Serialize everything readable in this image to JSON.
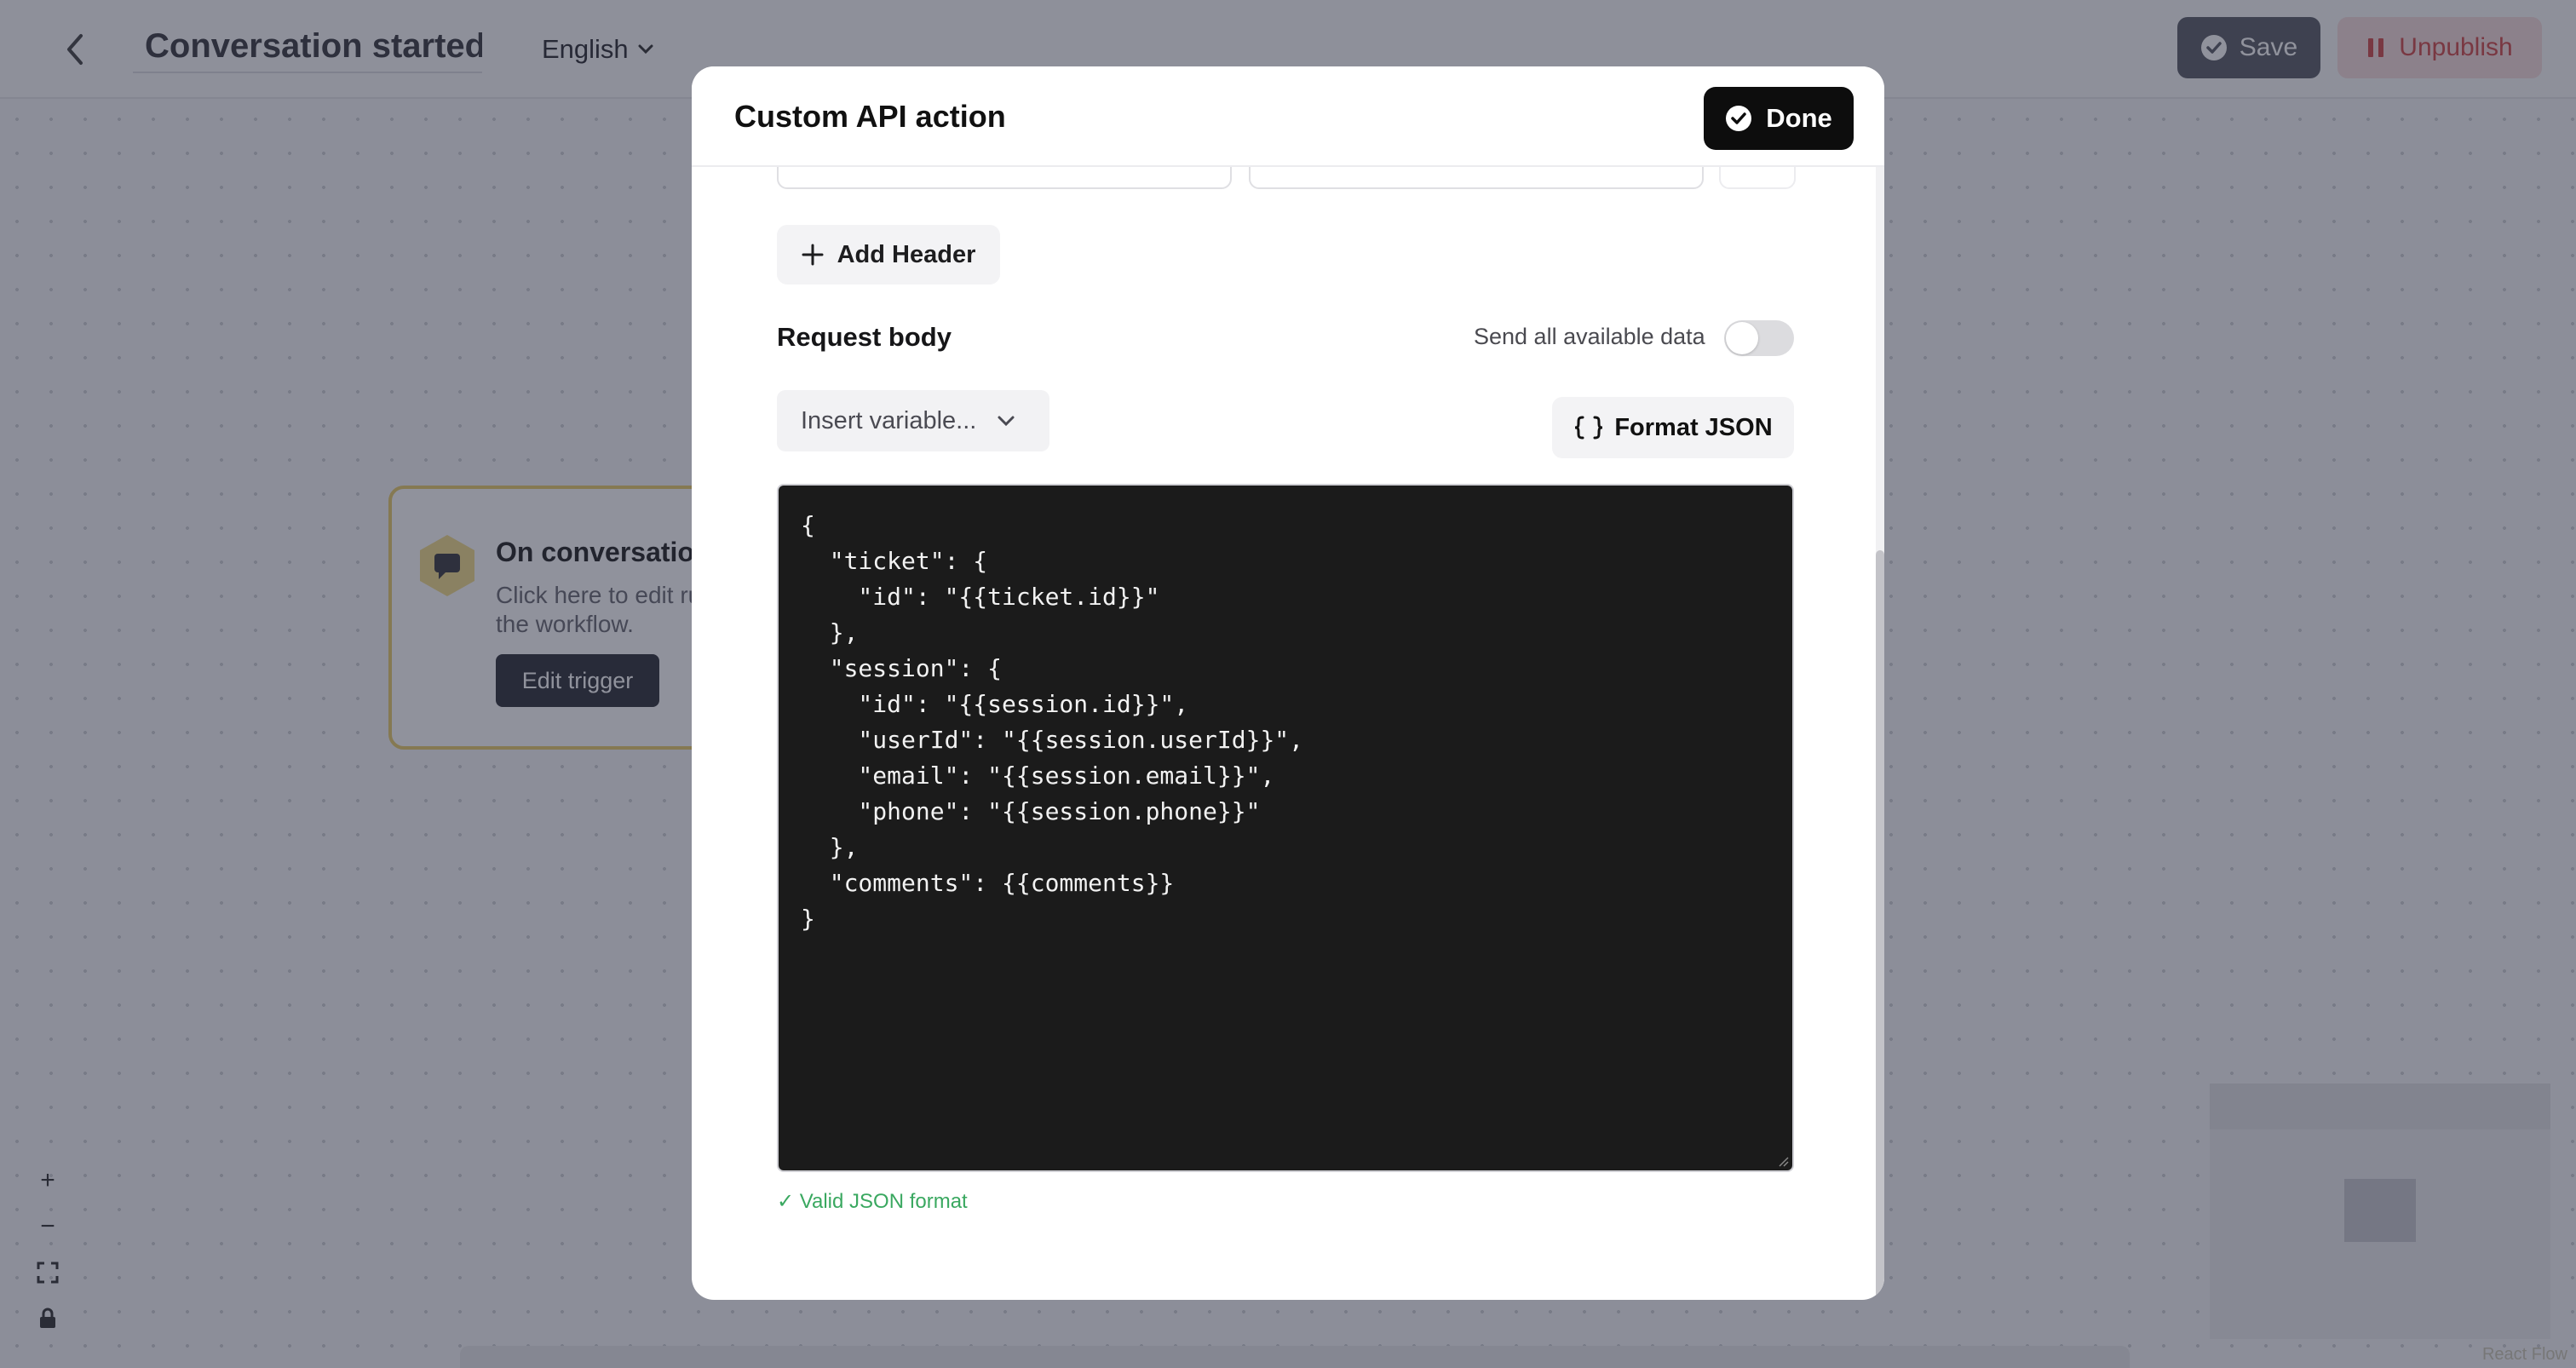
{
  "header": {
    "title": "Conversation started",
    "language": "English",
    "save_label": "Save",
    "unpublish_label": "Unpublish"
  },
  "trigger": {
    "title": "On conversatio",
    "description": "Click here to edit run the workflow.",
    "edit_label": "Edit trigger"
  },
  "canvas": {
    "zoom_in": "+",
    "zoom_out": "−",
    "attribution": "React Flow"
  },
  "modal": {
    "title": "Custom API action",
    "done_label": "Done",
    "add_header_label": "Add Header",
    "request_body_label": "Request body",
    "send_all_label": "Send all available data",
    "send_all_enabled": false,
    "insert_variable_placeholder": "Insert variable...",
    "format_json_label": "Format JSON",
    "body_json": "{\n  \"ticket\": {\n    \"id\": \"{{ticket.id}}\"\n  },\n  \"session\": {\n    \"id\": \"{{session.id}}\",\n    \"userId\": \"{{session.userId}}\",\n    \"email\": \"{{session.email}}\",\n    \"phone\": \"{{session.phone}}\"\n  },\n  \"comments\": {{comments}}\n}",
    "valid_message": "✓ Valid JSON format"
  },
  "colors": {
    "overlay": "#21263a",
    "done_bg": "#0d0d0d",
    "code_bg": "#1b1b1b",
    "valid_green": "#3aa860",
    "unpublish_text": "#d14a4a",
    "trigger_border": "#e9cd6a"
  }
}
